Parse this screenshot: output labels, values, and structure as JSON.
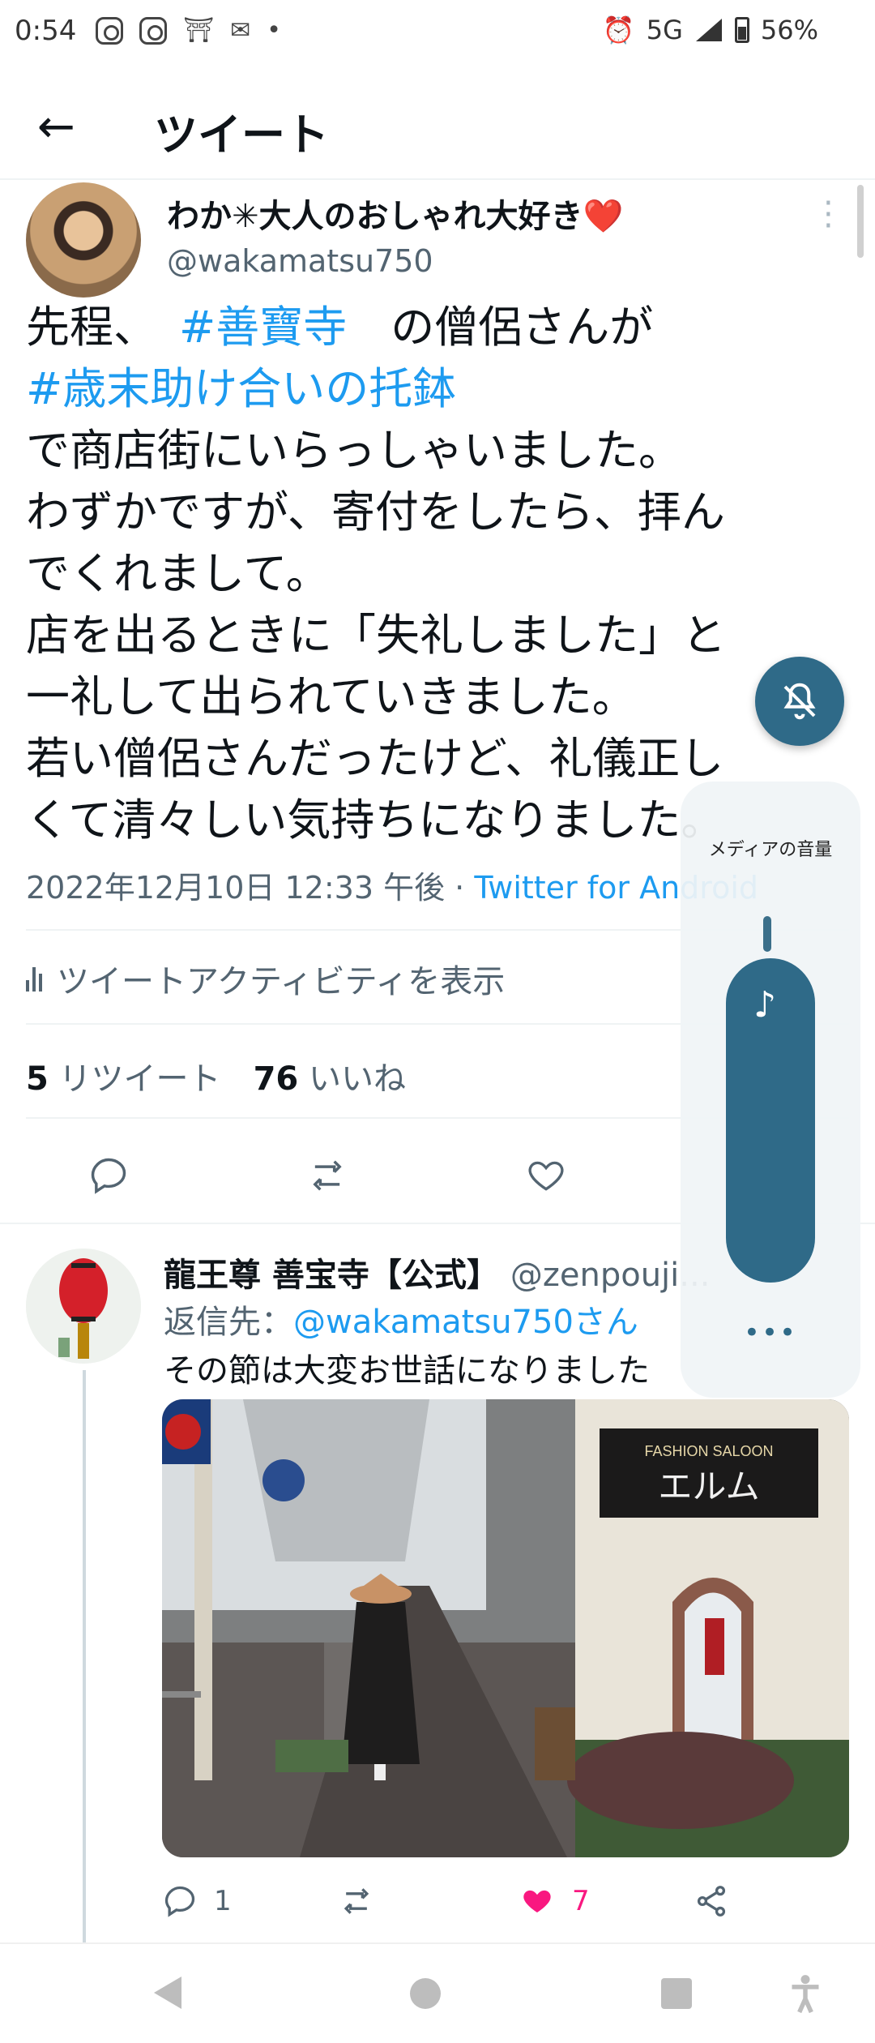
{
  "status_bar": {
    "time": "0:54",
    "network": "5G",
    "battery": "56%",
    "battery_level": 0.56
  },
  "header": {
    "title": "ツイート"
  },
  "tweet": {
    "author_name": "わか✳大人のおしゃれ大好き",
    "author_emoji": "❤️",
    "handle": "@wakamatsu750",
    "text": {
      "line1_prefix": "先程、",
      "hashtag1": "#善寶寺",
      "line1_suffix": "の僧侶さんが",
      "hashtag2": "#歳末助け合いの托鉢",
      "line3": "で商店街にいらっしゃいました。",
      "line4": "わずかですが、寄付をしたら、拝ん",
      "line5": "でくれまして。",
      "line6": "店を出るときに「失礼しました」と",
      "line7": "一礼して出られていきました。",
      "line8": "若い僧侶さんだったけど、礼儀正し",
      "line9": "くて清々しい気持ちになりました。"
    },
    "timestamp": "2022年12月10日 12:33 午後 · ",
    "via": "Twitter for Android",
    "activity_label": "ツイートアクティビティを表示",
    "retweet_count": "5",
    "retweet_label": "リツイート",
    "like_count": "76",
    "like_label": "いいね"
  },
  "reply": {
    "author_name": "龍王尊 善宝寺【公式】",
    "handle": "@zenpouji...",
    "reply_to_prefix": "返信先：",
    "reply_to_user": "@wakamatsu750さん",
    "text": "その節は大変お世話になりました",
    "photo_sign_top": "FASHION SALOON",
    "photo_sign_main": "エルム",
    "reply_count": "1",
    "like_count": "7"
  },
  "volume_overlay": {
    "label": "メディアの音量",
    "more": "•••",
    "level": 0.9
  },
  "colors": {
    "accent": "#1d9bf0",
    "like": "#f91880",
    "volume": "#2f6a88"
  }
}
